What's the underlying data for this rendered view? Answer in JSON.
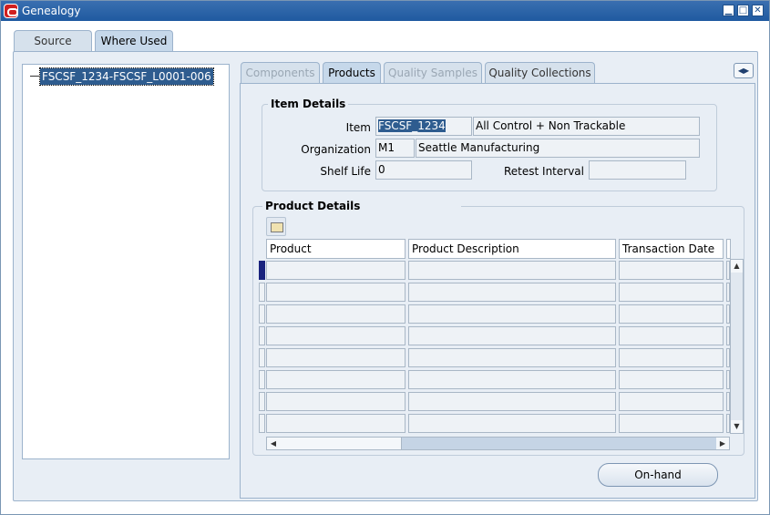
{
  "window": {
    "title": "Genealogy",
    "controls": [
      "minimize",
      "maximize",
      "close"
    ]
  },
  "top_tabs": [
    {
      "label": "Source",
      "active": false
    },
    {
      "label": "Where Used",
      "active": true
    }
  ],
  "tree": {
    "root_label": "FSCSF_1234-FSCSF_L0001-006"
  },
  "sub_tabs": [
    {
      "label": "Components",
      "state": "disabled"
    },
    {
      "label": "Products",
      "state": "active"
    },
    {
      "label": "Quality Samples",
      "state": "disabled"
    },
    {
      "label": "Quality Collections",
      "state": "enabled"
    }
  ],
  "item_details": {
    "title": "Item Details",
    "item_label": "Item",
    "item_value": "FSCSF_1234",
    "item_description": "All Control + Non Trackable",
    "org_label": "Organization",
    "org_code": "M1",
    "org_name": "Seattle Manufacturing",
    "shelf_life_label": "Shelf Life",
    "shelf_life_value": "0",
    "retest_label": "Retest Interval",
    "retest_value": ""
  },
  "product_details": {
    "title": "Product Details",
    "columns": [
      "Product",
      "Product Description",
      "Transaction Date"
    ],
    "row_count": 8
  },
  "buttons": {
    "onhand_label": "On-hand"
  },
  "colors": {
    "title_bar": "#1f5aa0",
    "selection": "#2e5c8f",
    "panel_bg": "#e8eef5"
  }
}
